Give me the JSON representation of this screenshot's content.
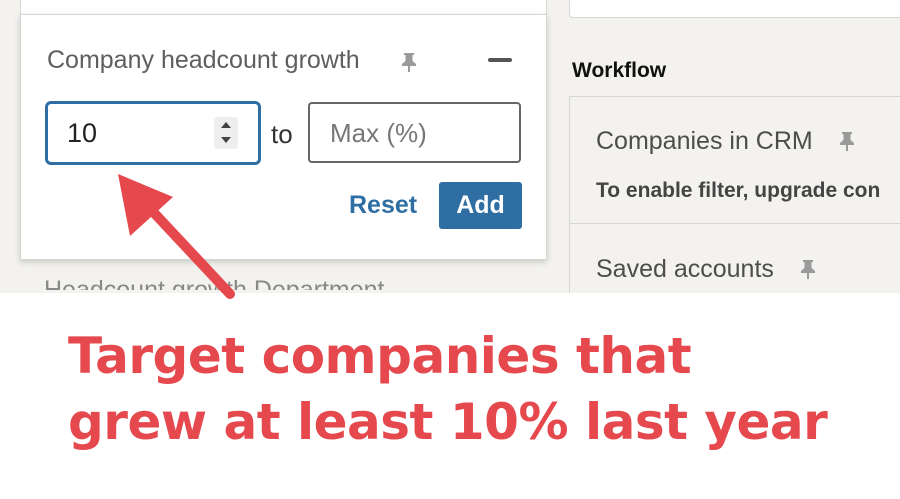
{
  "filter": {
    "title": "Company headcount growth",
    "min_value": "10",
    "to_label": "to",
    "max_placeholder": "Max (%)",
    "reset_label": "Reset",
    "add_label": "Add",
    "below_text": "Headcount growth    Department"
  },
  "workflow": {
    "heading": "Workflow",
    "items": [
      {
        "title": "Companies in CRM",
        "subtitle": "To enable filter, upgrade con"
      },
      {
        "title": "Saved accounts"
      }
    ]
  },
  "annotation": {
    "line1": "Target companies that",
    "line2": "grew at least 10% last year"
  },
  "colors": {
    "accent_blue": "#2f6ea3",
    "annotation_red": "#e5484d",
    "background": "#f3f2ef"
  }
}
